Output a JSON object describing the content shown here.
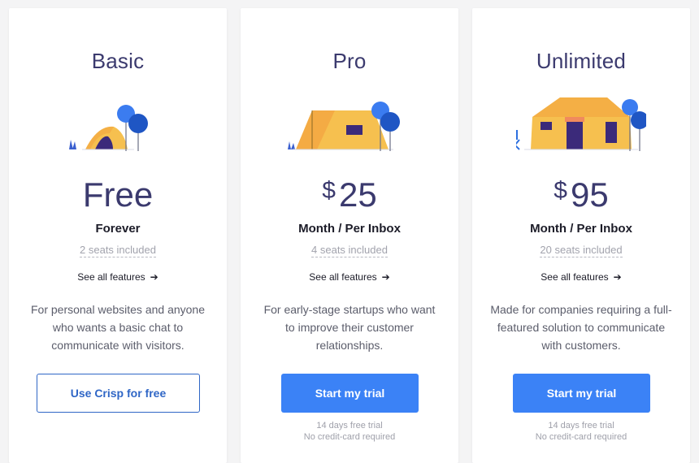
{
  "plans": [
    {
      "name": "Basic",
      "currency": "",
      "price": "Free",
      "period": "Forever",
      "seats": "2 seats included",
      "features_link": "See all features",
      "description": "For personal websites and anyone who wants a basic chat to communicate with visitors.",
      "cta": "Use Crisp for free",
      "cta_style": "outline",
      "note_line1": "",
      "note_line2": ""
    },
    {
      "name": "Pro",
      "currency": "$",
      "price": "25",
      "period": "Month / Per Inbox",
      "seats": "4 seats included",
      "features_link": "See all features",
      "description": "For early-stage startups who want to improve their customer relationships.",
      "cta": "Start my trial",
      "cta_style": "solid",
      "note_line1": "14 days free trial",
      "note_line2": "No credit-card required"
    },
    {
      "name": "Unlimited",
      "currency": "$",
      "price": "95",
      "period": "Month / Per Inbox",
      "seats": "20 seats included",
      "features_link": "See all features",
      "description": "Made for companies requiring a full-featured solution to communicate with customers.",
      "cta": "Start my trial",
      "cta_style": "solid",
      "note_line1": "14 days free trial",
      "note_line2": "No credit-card required"
    }
  ],
  "icons": {
    "features_arrow": "arrow-right-icon",
    "basic_illustration": "small-tent-illustration",
    "pro_illustration": "medium-tent-illustration",
    "unlimited_illustration": "large-tent-illustration"
  },
  "colors": {
    "background": "#f4f4f5",
    "card": "#ffffff",
    "plan_text": "#3b3a6e",
    "primary_button": "#3b82f6",
    "outline_button": "#2f66c6",
    "tent_yellow": "#f6c04f",
    "tent_orange": "#f4a340",
    "tree_blue": "#2c6fe0"
  }
}
